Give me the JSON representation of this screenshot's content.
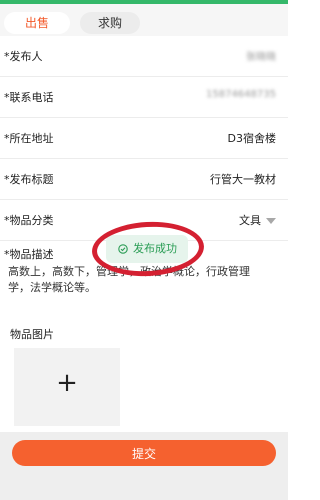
{
  "tabs": {
    "sell": "出售",
    "buy": "求购"
  },
  "fields": [
    {
      "label": "*发布人",
      "value": "张晓晓"
    },
    {
      "label": "*联系电话",
      "value": "15874648735"
    },
    {
      "label": "*所在地址",
      "value": "D3宿舍楼"
    },
    {
      "label": "*发布标题",
      "value": "行管大一教材"
    },
    {
      "label": "*物品分类",
      "value": "文具"
    }
  ],
  "description": {
    "label": "*物品描述",
    "text": "高数上，高数下，管理学，政治学概论，行政管理学，法学概论等。"
  },
  "images": {
    "label": "物品图片",
    "add_symbol": "+"
  },
  "toast": {
    "text": "发布成功"
  },
  "submit_label": "提交",
  "colors": {
    "accent": "#f5612f",
    "success": "#2a9d55",
    "annotation": "#d42031"
  }
}
